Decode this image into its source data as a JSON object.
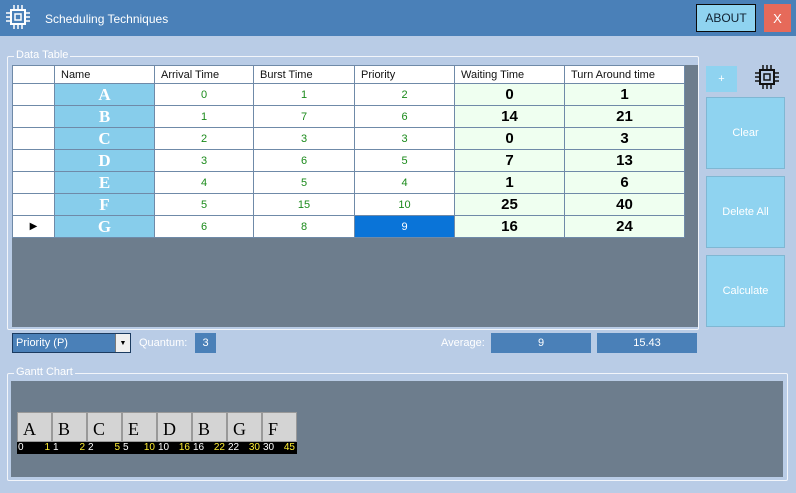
{
  "window": {
    "title": "Scheduling Techniques",
    "about_label": "ABOUT",
    "close_label": "X",
    "icon": "cpu-chip-icon"
  },
  "data_table": {
    "legend": "Data Table",
    "columns": [
      "Name",
      "Arrival Time",
      "Burst Time",
      "Priority",
      "Waiting Time",
      "Turn Around time"
    ],
    "rows": [
      {
        "name": "A",
        "arrival": "0",
        "burst": "1",
        "priority": "2",
        "waiting": "0",
        "turnaround": "1"
      },
      {
        "name": "B",
        "arrival": "1",
        "burst": "7",
        "priority": "6",
        "waiting": "14",
        "turnaround": "21"
      },
      {
        "name": "C",
        "arrival": "2",
        "burst": "3",
        "priority": "3",
        "waiting": "0",
        "turnaround": "3"
      },
      {
        "name": "D",
        "arrival": "3",
        "burst": "6",
        "priority": "5",
        "waiting": "7",
        "turnaround": "13"
      },
      {
        "name": "E",
        "arrival": "4",
        "burst": "5",
        "priority": "4",
        "waiting": "1",
        "turnaround": "6"
      },
      {
        "name": "F",
        "arrival": "5",
        "burst": "15",
        "priority": "10",
        "waiting": "25",
        "turnaround": "40"
      },
      {
        "name": "G",
        "arrival": "6",
        "burst": "8",
        "priority": "9",
        "waiting": "16",
        "turnaround": "24"
      }
    ],
    "current_row_marker": "▶"
  },
  "side_buttons": {
    "plus_label": "+",
    "clear_label": "Clear",
    "delete_all_label": "Delete All",
    "calculate_label": "Calculate"
  },
  "controls": {
    "algorithm_selected": "Priority (P)",
    "quantum_label": "Quantum:",
    "quantum_value": "3",
    "average_label": "Average:",
    "average_waiting": "9",
    "average_turnaround": "15.43"
  },
  "gantt": {
    "legend": "Gantt Chart",
    "blocks": [
      {
        "name": "A",
        "start": "0",
        "end": "1"
      },
      {
        "name": "B",
        "start": "1",
        "end": "2"
      },
      {
        "name": "C",
        "start": "2",
        "end": "5"
      },
      {
        "name": "E",
        "start": "5",
        "end": "10"
      },
      {
        "name": "D",
        "start": "10",
        "end": "16"
      },
      {
        "name": "B",
        "start": "16",
        "end": "22"
      },
      {
        "name": "G",
        "start": "22",
        "end": "30"
      },
      {
        "name": "F",
        "start": "30",
        "end": "45"
      }
    ]
  },
  "colors": {
    "titlebar": "#4a80b8",
    "background": "#b9cce6",
    "accent_button": "#8fd3f0",
    "close_button": "#e66a5a",
    "selection": "#0a74d8"
  }
}
